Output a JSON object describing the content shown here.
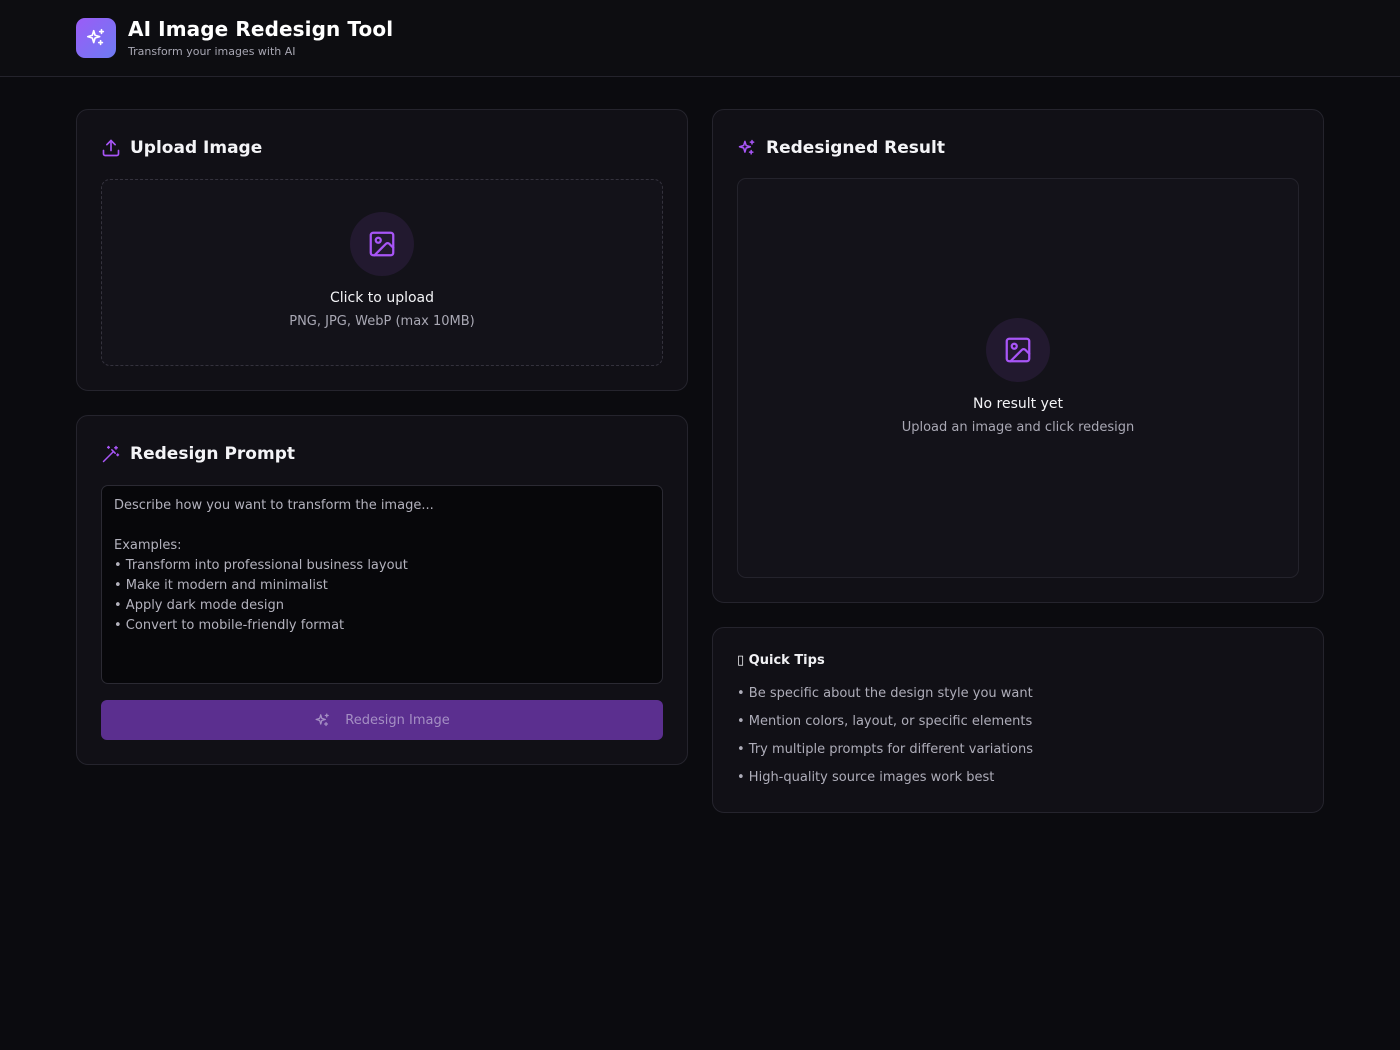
{
  "header": {
    "title": "AI Image Redesign Tool",
    "subtitle": "Transform your images with AI"
  },
  "upload": {
    "title": "Upload Image",
    "cta": "Click to upload",
    "formats": "PNG, JPG, WebP (max 10MB)"
  },
  "prompt": {
    "title": "Redesign Prompt",
    "placeholder": "Describe how you want to transform the image...\n\nExamples:\n• Transform into professional business layout\n• Make it modern and minimalist\n• Apply dark mode design\n• Convert to mobile-friendly format",
    "button_label": "Redesign Image"
  },
  "result": {
    "title": "Redesigned Result",
    "empty_title": "No result yet",
    "empty_subtitle": "Upload an image and click redesign"
  },
  "tips": {
    "title": "▯ Quick Tips",
    "items": [
      "• Be specific about the design style you want",
      "• Mention colors, layout, or specific elements",
      "• Try multiple prompts for different variations",
      "• High-quality source images work best"
    ]
  },
  "colors": {
    "accent": "#a855f7",
    "button_bg": "#5b2f8f",
    "background": "#0b0b0f",
    "card": "#111016"
  },
  "icons": {
    "logo": "sparkles-icon",
    "upload": "upload-icon",
    "prompt": "magic-wand-icon",
    "result": "sparkles-icon",
    "placeholder_image": "image-icon"
  }
}
